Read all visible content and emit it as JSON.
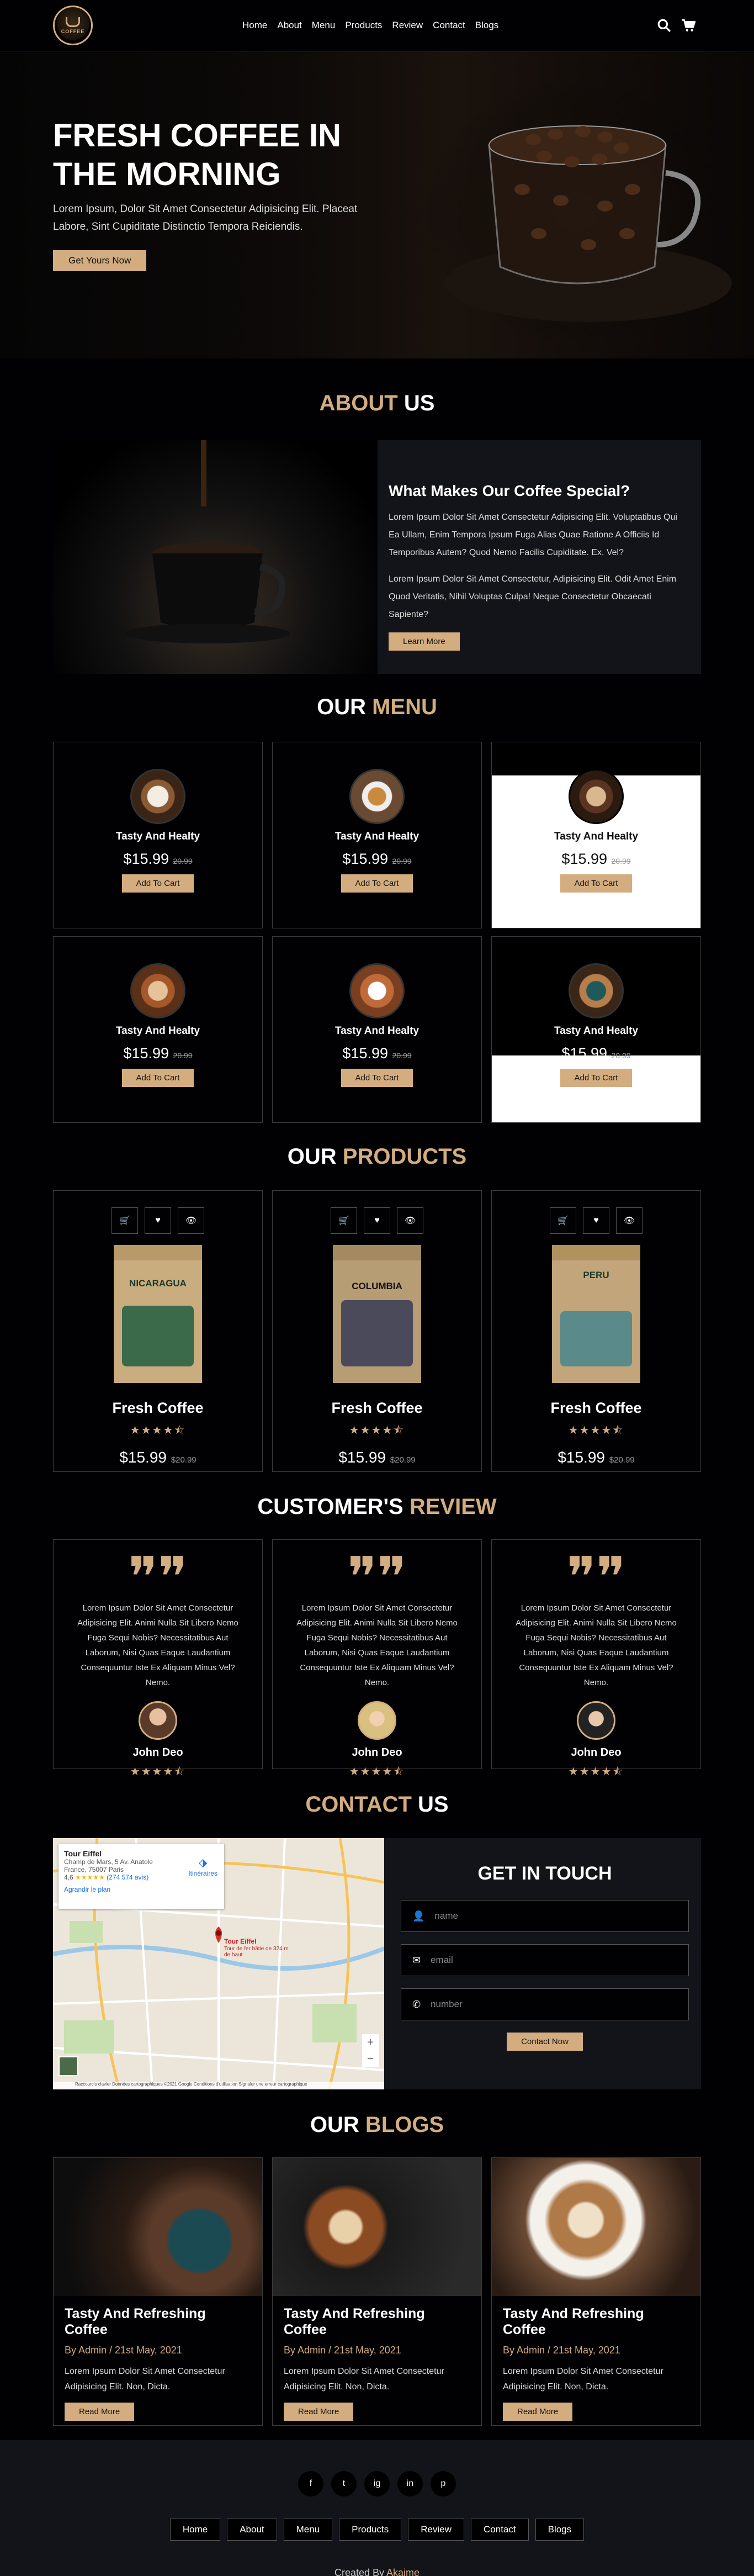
{
  "brand": {
    "logo_text": "COFFEE"
  },
  "nav": [
    "Home",
    "About",
    "Menu",
    "Products",
    "Review",
    "Contact",
    "Blogs"
  ],
  "hero": {
    "title": "FRESH COFFEE IN THE MORNING",
    "text": "Lorem Ipsum, Dolor Sit Amet Consectetur Adipisicing Elit. Placeat Labore, Sint Cupiditate Distinctio Tempora Reiciendis.",
    "button": "Get Yours Now"
  },
  "about": {
    "title_a": "ABOUT",
    "title_b": "US",
    "heading": "What Makes Our Coffee Special?",
    "p1": "Lorem Ipsum Dolor Sit Amet Consectetur Adipisicing Elit. Voluptatibus Qui Ea Ullam, Enim Tempora Ipsum Fuga Alias Quae Ratione A Officiis Id Temporibus Autem? Quod Nemo Facilis Cupiditate. Ex, Vel?",
    "p2": "Lorem Ipsum Dolor Sit Amet Consectetur, Adipisicing Elit. Odit Amet Enim Quod Veritatis, Nihil Voluptas Culpa! Neque Consectetur Obcaecati Sapiente?",
    "button": "Learn More"
  },
  "menu": {
    "title_a": "OUR",
    "title_b": "MENU",
    "items": [
      {
        "name": "Tasty And Healty",
        "price": "$15.99",
        "old": "20.99",
        "button": "Add To Cart"
      },
      {
        "name": "Tasty And Healty",
        "price": "$15.99",
        "old": "20.99",
        "button": "Add To Cart"
      },
      {
        "name": "Tasty And Healty",
        "price": "$15.99",
        "old": "20.99",
        "button": "Add To Cart"
      },
      {
        "name": "Tasty And Healty",
        "price": "$15.99",
        "old": "20.99",
        "button": "Add To Cart"
      },
      {
        "name": "Tasty And Healty",
        "price": "$15.99",
        "old": "20.99",
        "button": "Add To Cart"
      },
      {
        "name": "Tasty And Healty",
        "price": "$15.99",
        "old": "20.99",
        "button": "Add To Cart"
      }
    ]
  },
  "products": {
    "title_a": "OUR",
    "title_b": "PRODUCTS",
    "items": [
      {
        "label": "NICARAGUA",
        "name": "Fresh Coffee",
        "price": "$15.99",
        "old": "$20.99",
        "rating": 4.5
      },
      {
        "label": "COLUMBIA",
        "name": "Fresh Coffee",
        "price": "$15.99",
        "old": "$20.99",
        "rating": 4.5
      },
      {
        "label": "PERU",
        "name": "Fresh Coffee",
        "price": "$15.99",
        "old": "$20.99",
        "rating": 4.5
      }
    ]
  },
  "reviews": {
    "title_a": "CUSTOMER'S",
    "title_b": "REVIEW",
    "items": [
      {
        "text": "Lorem Ipsum Dolor Sit Amet Consectetur Adipisicing Elit. Animi Nulla Sit Libero Nemo Fuga Sequi Nobis? Necessitatibus Aut Laborum, Nisi Quas Eaque Laudantium Consequuntur Iste Ex Aliquam Minus Vel? Nemo.",
        "name": "John Deo",
        "rating": 4.5
      },
      {
        "text": "Lorem Ipsum Dolor Sit Amet Consectetur Adipisicing Elit. Animi Nulla Sit Libero Nemo Fuga Sequi Nobis? Necessitatibus Aut Laborum, Nisi Quas Eaque Laudantium Consequuntur Iste Ex Aliquam Minus Vel? Nemo.",
        "name": "John Deo",
        "rating": 4.5
      },
      {
        "text": "Lorem Ipsum Dolor Sit Amet Consectetur Adipisicing Elit. Animi Nulla Sit Libero Nemo Fuga Sequi Nobis? Necessitatibus Aut Laborum, Nisi Quas Eaque Laudantium Consequuntur Iste Ex Aliquam Minus Vel? Nemo.",
        "name": "John Deo",
        "rating": 4.5
      }
    ]
  },
  "contact": {
    "title_a": "CONTACT",
    "title_b": "US",
    "heading": "GET IN TOUCH",
    "name_ph": "name",
    "email_ph": "email",
    "number_ph": "number",
    "button": "Contact Now",
    "map": {
      "place": "Tour Eiffel",
      "address": "Champ de Mars, 5 Av. Anatole France, 75007 Paris",
      "rating": "4,6",
      "reviews": "(274 574 avis)",
      "link": "Agrandir le plan",
      "directions": "Itinéraires",
      "pin_label": "Tour Eiffel",
      "pin_sub": "Tour de fer bâtie de 324 m de haut",
      "attrib": "Raccourcis clavier  Données cartographiques ©2021 Google  Conditions d'utilisation  Signaler une erreur cartographique"
    }
  },
  "blogs": {
    "title_a": "OUR",
    "title_b": "BLOGS",
    "items": [
      {
        "title": "Tasty And Refreshing Coffee",
        "meta": "By Admin / 21st May, 2021",
        "text": "Lorem Ipsum Dolor Sit Amet Consectetur Adipisicing Elit. Non, Dicta.",
        "button": "Read More"
      },
      {
        "title": "Tasty And Refreshing Coffee",
        "meta": "By Admin / 21st May, 2021",
        "text": "Lorem Ipsum Dolor Sit Amet Consectetur Adipisicing Elit. Non, Dicta.",
        "button": "Read More"
      },
      {
        "title": "Tasty And Refreshing Coffee",
        "meta": "By Admin / 21st May, 2021",
        "text": "Lorem Ipsum Dolor Sit Amet Consectetur Adipisicing Elit. Non, Dicta.",
        "button": "Read More"
      }
    ]
  },
  "footer": {
    "social": [
      "f",
      "t",
      "ig",
      "in",
      "p"
    ],
    "links": [
      "Home",
      "About",
      "Menu",
      "Products",
      "Review",
      "Contact",
      "Blogs"
    ],
    "credit_a": "Created By",
    "credit_b": "Akaime"
  },
  "colors": {
    "accent": "#d3ad7f",
    "bg": "#010103",
    "panel": "#13131a"
  }
}
